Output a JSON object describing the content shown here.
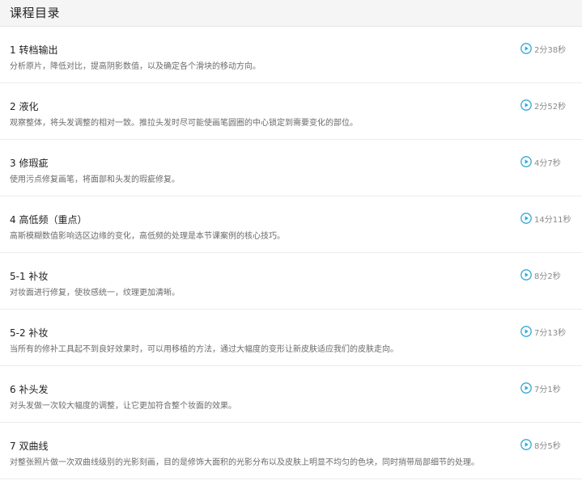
{
  "header": {
    "title": "课程目录"
  },
  "icons": {
    "play": "play-circle-icon",
    "accent": "#33a8d8"
  },
  "lessons": [
    {
      "title": "1 转档输出",
      "desc": "分析原片，降低对比，提高阴影数值，以及确定各个滑块的移动方向。",
      "duration": "2分38秒"
    },
    {
      "title": "2 液化",
      "desc": "观察整体，将头发调整的相对一致。推拉头发时尽可能使画笔圆圈的中心锁定到需要变化的部位。",
      "duration": "2分52秒"
    },
    {
      "title": "3 修瑕疵",
      "desc": "使用污点修复画笔，将面部和头发的瑕疵修复。",
      "duration": "4分7秒"
    },
    {
      "title": "4 高低频（重点）",
      "desc": "高斯模糊数值影响选区边缘的变化，高低频的处理是本节课案例的核心技巧。",
      "duration": "14分11秒"
    },
    {
      "title": "5-1 补妆",
      "desc": "对妆面进行修复，使妆感统一，纹理更加清晰。",
      "duration": "8分2秒"
    },
    {
      "title": "5-2 补妆",
      "desc": "当所有的修补工具起不到良好效果时，可以用移植的方法，通过大幅度的变形让新皮肤适应我们的皮肤走向。",
      "duration": "7分13秒"
    },
    {
      "title": "6 补头发",
      "desc": "对头发做一次较大幅度的调整，让它更加符合整个妆面的效果。",
      "duration": "7分1秒"
    },
    {
      "title": "7 双曲线",
      "desc": "对整张照片做一次双曲线级别的光影刻画，目的是修饰大面积的光影分布以及皮肤上明显不均匀的色块，同时捎带局部细节的处理。",
      "duration": "8分5秒"
    }
  ]
}
